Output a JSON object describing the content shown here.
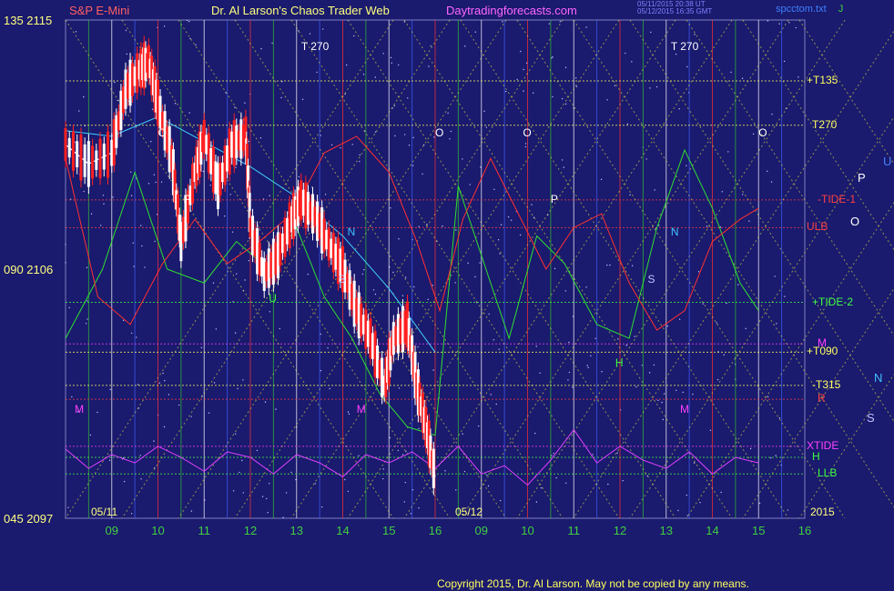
{
  "header": {
    "symbol": "S&P E-Mini",
    "title": "Dr. Al Larson's Chaos Trader Web",
    "site": "Daytradingforecasts.com",
    "timestamps": [
      "05/11/2015 20:38 UT",
      "05/12/2015 16:35 GMT"
    ],
    "file": "spcctom.txt",
    "file_suffix": "J"
  },
  "copyright": "Copyright 2015, Dr. Al Larson. May not be copied by any means.",
  "colors": {
    "background": "#1a1a6e",
    "price_candles_up": "#ffffff",
    "price_candles_down": "#ff2020",
    "cyan_average": "#40d0ff",
    "green_tide": "#30e030",
    "red_tide": "#ff3030",
    "magenta_xtide": "#e040ff",
    "gann_lines": "#e0e040"
  },
  "chart_data": {
    "type": "line",
    "x_axis": {
      "ticks": [
        "09",
        "10",
        "11",
        "12",
        "13",
        "14",
        "15",
        "16",
        "09",
        "10",
        "11",
        "12",
        "13",
        "14",
        "15",
        "16"
      ],
      "date_labels": [
        "05/11",
        "05/12"
      ],
      "year": "2015",
      "range_hours": [
        8,
        24
      ]
    },
    "y_axis": {
      "ticks": [
        {
          "angle": "135",
          "price": "2115"
        },
        {
          "angle": "090",
          "price": "2106"
        },
        {
          "angle": "045",
          "price": "2097"
        }
      ],
      "range": [
        2097,
        2115
      ]
    },
    "right_labels": [
      {
        "text": "+T135",
        "color": "#ffff60",
        "price": 2112.8
      },
      {
        "text": "T270",
        "color": "#ffff60",
        "price": 2111.2
      },
      {
        "text": "-TIDE-1",
        "color": "#ff4040",
        "price": 2108.5
      },
      {
        "text": "ULB",
        "color": "#ff4040",
        "price": 2107.5
      },
      {
        "text": "+TIDE-2",
        "color": "#40ff40",
        "price": 2104.8
      },
      {
        "text": "M",
        "color": "#ff40ff",
        "price": 2103.3
      },
      {
        "text": "+T090",
        "color": "#ffff60",
        "price": 2103.0
      },
      {
        "text": "-T315",
        "color": "#ffff60",
        "price": 2101.8
      },
      {
        "text": "R",
        "color": "#ff4040",
        "price": 2101.3
      },
      {
        "text": "XTIDE",
        "color": "#ff40ff",
        "price": 2099.6
      },
      {
        "text": "H",
        "color": "#40ff40",
        "price": 2099.2
      },
      {
        "text": "LLB",
        "color": "#40ff40",
        "price": 2098.6
      }
    ],
    "side_letters": [
      {
        "text": "U",
        "color": "#4080ff"
      },
      {
        "text": "P",
        "color": "#ffffff"
      },
      {
        "text": "O",
        "color": "#ffffff"
      },
      {
        "text": "N",
        "color": "#40c0ff"
      },
      {
        "text": "S",
        "color": "#c0c0ff"
      }
    ],
    "chart_markers": [
      {
        "text": "T  270",
        "color": "#ffffff",
        "x": 13.1,
        "price": 2114.0
      },
      {
        "text": "T  270",
        "color": "#ffffff",
        "x": 21.1,
        "price": 2114.0
      },
      {
        "text": "O",
        "color": "#ffffff",
        "x": 10.0,
        "price": 2110.9
      },
      {
        "text": "O",
        "color": "#ffffff",
        "x": 16.0,
        "price": 2110.9
      },
      {
        "text": "O",
        "color": "#ffffff",
        "x": 17.9,
        "price": 2110.9
      },
      {
        "text": "O",
        "color": "#ffffff",
        "x": 23.0,
        "price": 2110.9
      },
      {
        "text": "P",
        "color": "#ffffff",
        "x": 10.55,
        "price": 2108.5
      },
      {
        "text": "P",
        "color": "#ffffff",
        "x": 18.5,
        "price": 2108.5
      },
      {
        "text": "N",
        "color": "#40c0ff",
        "x": 14.1,
        "price": 2107.3
      },
      {
        "text": "N",
        "color": "#40c0ff",
        "x": 21.1,
        "price": 2107.3
      },
      {
        "text": "S",
        "color": "#c0c0ff",
        "x": 13.9,
        "price": 2105.6
      },
      {
        "text": "S",
        "color": "#c0c0ff",
        "x": 20.6,
        "price": 2105.6
      },
      {
        "text": "M",
        "color": "#ff40ff",
        "x": 8.2,
        "price": 2100.9
      },
      {
        "text": "M",
        "color": "#ff40ff",
        "x": 14.3,
        "price": 2100.9
      },
      {
        "text": "M",
        "color": "#ff40ff",
        "x": 21.3,
        "price": 2100.9
      },
      {
        "text": "H",
        "color": "#40ff40",
        "x": 19.9,
        "price": 2102.6
      },
      {
        "text": "U",
        "color": "#40ff40",
        "x": 12.4,
        "price": 2104.9
      }
    ],
    "series": [
      {
        "name": "price",
        "color": "#ffffff",
        "x": [
          8,
          8.5,
          9,
          9.3,
          9.6,
          9.8,
          10.0,
          10.3,
          10.5,
          10.8,
          11.0,
          11.3,
          11.6,
          11.9,
          12.0,
          12.3,
          12.6,
          12.9,
          13.1,
          13.4,
          13.7,
          14.0,
          14.3,
          14.6,
          14.9,
          15.1,
          15.4,
          15.6,
          15.8,
          16.0
        ],
        "y": [
          2110.5,
          2109.8,
          2110.2,
          2112.5,
          2113.2,
          2113.5,
          2112.0,
          2110.0,
          2107.0,
          2109.5,
          2110.8,
          2109.0,
          2110.5,
          2110.8,
          2107.5,
          2105.8,
          2106.5,
          2107.8,
          2108.5,
          2107.9,
          2106.9,
          2106.0,
          2104.5,
          2103.5,
          2101.8,
          2103.5,
          2104.0,
          2101.8,
          2100.3,
          2098.5
        ]
      },
      {
        "name": "cyan",
        "color": "#40d0ff",
        "x": [
          8,
          9,
          10,
          11,
          12,
          13,
          14,
          15,
          16
        ],
        "y": [
          2111.0,
          2110.8,
          2111.5,
          2110.6,
          2109.7,
          2108.6,
          2107.2,
          2105.3,
          2103.0
        ]
      },
      {
        "name": "green",
        "color": "#30e030",
        "x": [
          8,
          8.8,
          9.5,
          10.2,
          11,
          11.7,
          12.4,
          13,
          13.6,
          14.2,
          14.8,
          15.4,
          16,
          16.5,
          17,
          17.6,
          18.2,
          18.8,
          19.5,
          20.2,
          20.8,
          21.4,
          22.0,
          22.6,
          23
        ],
        "y": [
          2103.5,
          2106,
          2109.5,
          2106,
          2105.5,
          2107,
          2106,
          2107.5,
          2105,
          2103.5,
          2101.5,
          2100.3,
          2100,
          2109,
          2106.5,
          2103.5,
          2107.2,
          2106.2,
          2104.0,
          2103.5,
          2107.5,
          2110.3,
          2108.2,
          2105.5,
          2104.5
        ]
      },
      {
        "name": "red",
        "color": "#ff3030",
        "x": [
          8,
          8.7,
          9.4,
          10.1,
          10.8,
          11.5,
          12.2,
          12.9,
          13.6,
          14.3,
          15,
          15.6,
          16.1,
          16.6,
          17.2,
          17.8,
          18.4,
          19,
          19.6,
          20.2,
          20.8,
          21.4,
          22,
          22.6,
          23
        ],
        "y": [
          2110,
          2105,
          2104,
          2106.2,
          2107.8,
          2106.2,
          2107,
          2108,
          2110.2,
          2110.8,
          2109.5,
          2107.0,
          2104.5,
          2107.8,
          2110.0,
          2108.0,
          2106.0,
          2107.5,
          2108.0,
          2105.5,
          2103.8,
          2104.5,
          2107.0,
          2107.8,
          2108.2
        ]
      },
      {
        "name": "magenta",
        "color": "#e040ff",
        "x": [
          8,
          8.5,
          9,
          9.5,
          10,
          10.5,
          11,
          11.5,
          12,
          12.5,
          13,
          13.5,
          14,
          14.5,
          15,
          15.5,
          16,
          16.5,
          17,
          17.5,
          18,
          18.5,
          19,
          19.5,
          20,
          20.5,
          21,
          21.5,
          22,
          22.5,
          23
        ],
        "y": [
          2099.5,
          2098.8,
          2099.3,
          2099.0,
          2099.6,
          2099.2,
          2098.7,
          2099.4,
          2099.2,
          2098.6,
          2099.3,
          2099.0,
          2098.5,
          2099.3,
          2099.0,
          2099.4,
          2098.8,
          2099.6,
          2098.6,
          2098.9,
          2098.2,
          2099.1,
          2100.2,
          2099.0,
          2099.6,
          2099.1,
          2098.8,
          2099.4,
          2098.6,
          2099.2,
          2099.0
        ]
      }
    ]
  }
}
